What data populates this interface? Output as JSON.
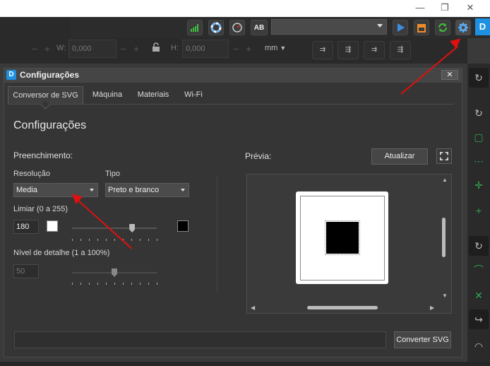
{
  "toolbar": {
    "speed_label": "AB",
    "device_select_value": "",
    "width_label": "W:",
    "width_value": "0,000",
    "height_label": "H:",
    "height_value": "0,000",
    "unit": "mm"
  },
  "dialog": {
    "title": "Configurações",
    "close_symbol": "✕",
    "tabs": [
      {
        "label": "Conversor de SVG",
        "active": true
      },
      {
        "label": "Máquina",
        "active": false
      },
      {
        "label": "Materiais",
        "active": false
      },
      {
        "label": "Wi-Fi",
        "active": false
      }
    ],
    "heading": "Configurações",
    "fill_section_label": "Preenchimento:",
    "resolution": {
      "label": "Resolução",
      "value": "Media"
    },
    "type": {
      "label": "Tipo",
      "value": "Preto e branco"
    },
    "threshold": {
      "label": "Limiar (0 a 255)",
      "value": "180",
      "level": 0.71
    },
    "detail": {
      "label": "Nível de detalhe (1 a 100%)",
      "value": "50",
      "level": 0.5
    },
    "preview_label": "Prévia:",
    "update_button": "Atualizar",
    "convert_button": "Converter SVG",
    "path_value": ""
  },
  "colors": {
    "accent": "#1e90e0",
    "annotation_arrow": "#e01010",
    "wifi_green": "#3fbf3f",
    "play_blue": "#3a8ee6",
    "orange": "#f28c28"
  }
}
